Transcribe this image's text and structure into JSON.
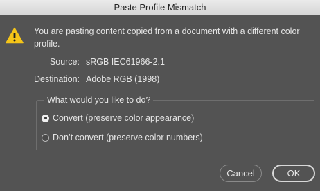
{
  "window": {
    "title": "Paste Profile Mismatch"
  },
  "message": {
    "icon": "warning-icon",
    "text": "You are pasting content copied from a document with a different color profile."
  },
  "profiles": {
    "source_label": "Source:",
    "source_value": "sRGB IEC61966-2.1",
    "destination_label": "Destination:",
    "destination_value": "Adobe RGB (1998)"
  },
  "options": {
    "legend": "What would you like to do?",
    "items": [
      {
        "label": "Convert (preserve color appearance)",
        "selected": true
      },
      {
        "label": "Don’t convert (preserve color numbers)",
        "selected": false
      }
    ]
  },
  "buttons": {
    "cancel_label": "Cancel",
    "ok_label": "OK"
  },
  "colors": {
    "background": "#535353",
    "warning": "#f5c518"
  }
}
